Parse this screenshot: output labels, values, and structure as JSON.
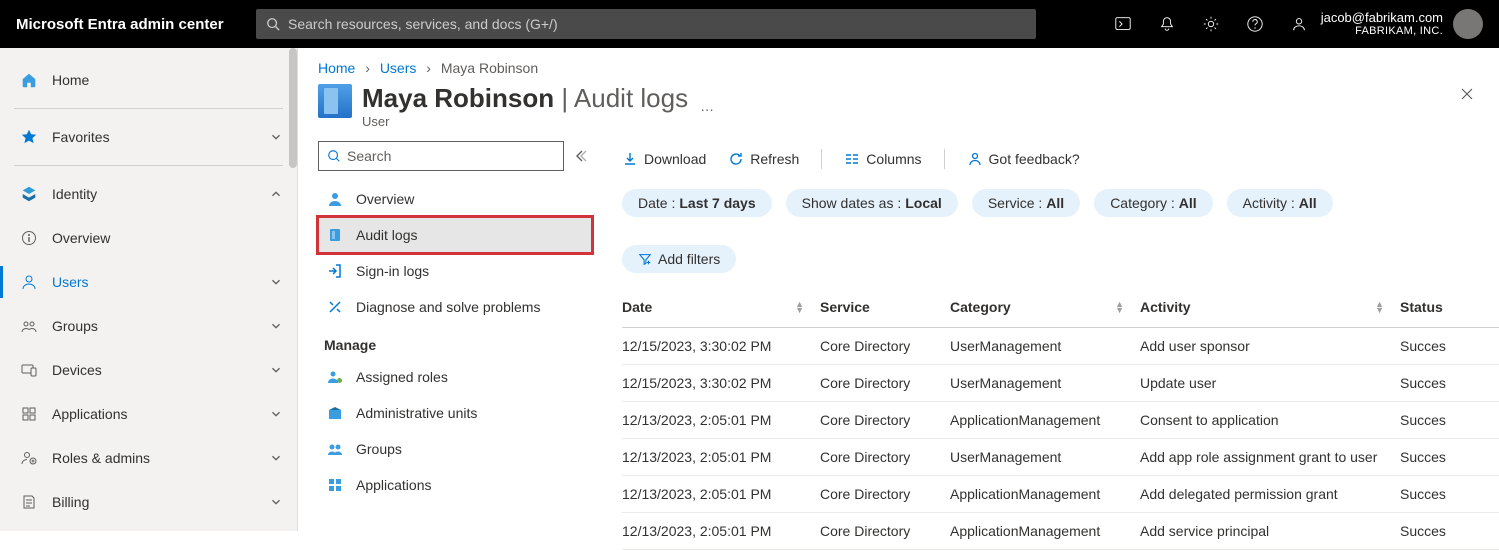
{
  "topbar": {
    "brand": "Microsoft Entra admin center",
    "search_placeholder": "Search resources, services, and docs (G+/)",
    "user_email": "jacob@fabrikam.com",
    "user_org": "FABRIKAM, INC."
  },
  "leftnav": {
    "home": "Home",
    "favorites": "Favorites",
    "identity": "Identity",
    "overview": "Overview",
    "users": "Users",
    "groups": "Groups",
    "devices": "Devices",
    "applications": "Applications",
    "roles_admins": "Roles & admins",
    "billing": "Billing"
  },
  "breadcrumb": {
    "home": "Home",
    "users": "Users",
    "current": "Maya Robinson"
  },
  "header": {
    "title_main": "Maya Robinson",
    "title_sep": " | ",
    "title_sub": "Audit logs",
    "subtitle": "User",
    "more": "…"
  },
  "rmenu": {
    "search_placeholder": "Search",
    "overview": "Overview",
    "audit_logs": "Audit logs",
    "signin_logs": "Sign-in logs",
    "diagnose": "Diagnose and solve problems",
    "manage_heading": "Manage",
    "assigned_roles": "Assigned roles",
    "admin_units": "Administrative units",
    "groups": "Groups",
    "applications": "Applications"
  },
  "cmdbar": {
    "download": "Download",
    "refresh": "Refresh",
    "columns": "Columns",
    "feedback": "Got feedback?"
  },
  "pills": {
    "date_k": "Date : ",
    "date_v": "Last 7 days",
    "show_k": "Show dates as : ",
    "show_v": "Local",
    "service_k": "Service : ",
    "service_v": "All",
    "category_k": "Category : ",
    "category_v": "All",
    "activity_k": "Activity : ",
    "activity_v": "All",
    "add_filters": "Add filters"
  },
  "table": {
    "cols": {
      "date": "Date",
      "service": "Service",
      "category": "Category",
      "activity": "Activity",
      "status": "Status"
    },
    "rows": [
      {
        "date": "12/15/2023, 3:30:02 PM",
        "service": "Core Directory",
        "category": "UserManagement",
        "activity": "Add user sponsor",
        "status": "Succes"
      },
      {
        "date": "12/15/2023, 3:30:02 PM",
        "service": "Core Directory",
        "category": "UserManagement",
        "activity": "Update user",
        "status": "Succes"
      },
      {
        "date": "12/13/2023, 2:05:01 PM",
        "service": "Core Directory",
        "category": "ApplicationManagement",
        "activity": "Consent to application",
        "status": "Succes"
      },
      {
        "date": "12/13/2023, 2:05:01 PM",
        "service": "Core Directory",
        "category": "UserManagement",
        "activity": "Add app role assignment grant to user",
        "status": "Succes"
      },
      {
        "date": "12/13/2023, 2:05:01 PM",
        "service": "Core Directory",
        "category": "ApplicationManagement",
        "activity": "Add delegated permission grant",
        "status": "Succes"
      },
      {
        "date": "12/13/2023, 2:05:01 PM",
        "service": "Core Directory",
        "category": "ApplicationManagement",
        "activity": "Add service principal",
        "status": "Succes"
      }
    ]
  }
}
